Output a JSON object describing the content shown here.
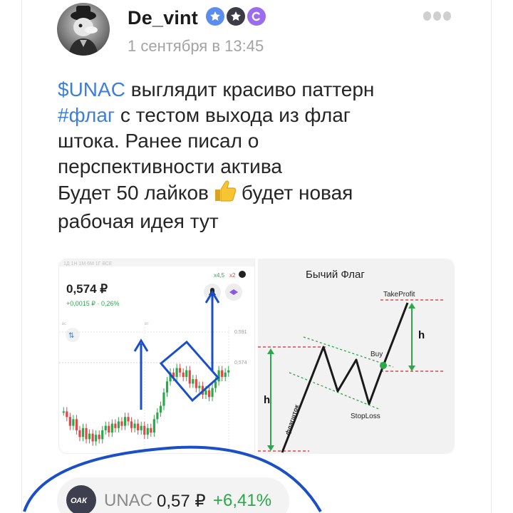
{
  "post": {
    "author": "De_vint",
    "date": "1 сентября в 13:45",
    "text_lines": [
      {
        "tag": "$UNAC",
        "rest": " выглядит красиво паттерн"
      },
      {
        "tag": "#флаг",
        "rest": " с тестом выхода из флаг"
      },
      {
        "tag": "",
        "rest": "штока. Ранее писал о"
      },
      {
        "tag": "",
        "rest": "перспективности актива"
      },
      {
        "before": "Будет 50 лайков",
        "after": "будет новая"
      },
      {
        "tag": "",
        "rest": "рабочая идея тут"
      }
    ],
    "badges": [
      "star-badge-icon",
      "star-badge-icon",
      "c-badge-icon"
    ],
    "more_icon": "more-dots-icon"
  },
  "left_image": {
    "tabs": "1Д 1Н 1М 6М 1Г ВСЕ",
    "price": "0,574 ₽",
    "change": "+0,0015 ₽ · 0,26%",
    "chips": [
      "x4,5",
      "x2"
    ],
    "axis_labels": [
      "0,591",
      "0,574"
    ],
    "grid_labels": [
      "вс",
      "вт"
    ]
  },
  "right_image": {
    "title": "Бычий Флаг",
    "labels": {
      "take_profit": "TakeProfit",
      "buy": "Buy",
      "stop_loss": "StopLoss",
      "h_left": "h",
      "h_right": "h",
      "pole": "флагшток"
    }
  },
  "ticker_chip": {
    "logo_text": "ОАК",
    "ticker": "UNAC",
    "price": "0,57 ₽",
    "change": "+6,41%"
  },
  "colors": {
    "tag": "#3d7fd9",
    "up": "#2ba84a",
    "down": "#e04848",
    "annotation": "#1a4fc8"
  }
}
